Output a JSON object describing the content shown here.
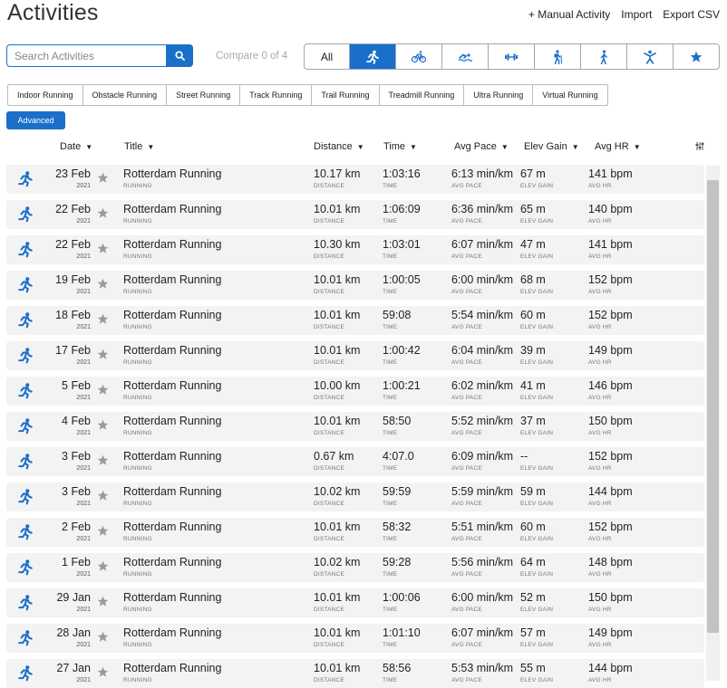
{
  "page": {
    "title": "Activities"
  },
  "actions": {
    "manual": "+ Manual Activity",
    "import": "Import",
    "export": "Export CSV"
  },
  "search": {
    "placeholder": "Search Activities"
  },
  "compare": {
    "label": "Compare 0 of 4"
  },
  "sport_filter": [
    {
      "label": "All",
      "icon": ""
    },
    {
      "label": "",
      "icon": "running-icon",
      "active": true
    },
    {
      "label": "",
      "icon": "cycling-icon"
    },
    {
      "label": "",
      "icon": "swimming-icon"
    },
    {
      "label": "",
      "icon": "strength-icon"
    },
    {
      "label": "",
      "icon": "hiking-icon"
    },
    {
      "label": "",
      "icon": "walking-icon"
    },
    {
      "label": "",
      "icon": "fitness-icon"
    },
    {
      "label": "",
      "icon": "favorite-star-icon"
    }
  ],
  "subtypes": [
    "Indoor Running",
    "Obstacle Running",
    "Street Running",
    "Track Running",
    "Trail Running",
    "Treadmill Running",
    "Ultra Running",
    "Virtual Running"
  ],
  "advanced": {
    "label": "Advanced"
  },
  "columns": {
    "date": "Date",
    "title": "Title",
    "distance": "Distance",
    "time": "Time",
    "avg_pace": "Avg Pace",
    "elev_gain": "Elev Gain",
    "avg_hr": "Avg HR"
  },
  "sublabels": {
    "type": "RUNNING",
    "distance": "DISTANCE",
    "time": "TIME",
    "pace": "AVG PACE",
    "elev": "ELEV GAIN",
    "hr": "AVG HR"
  },
  "activities": [
    {
      "day": "23 Feb",
      "year": "2021",
      "title": "Rotterdam Running",
      "distance": "10.17 km",
      "time": "1:03:16",
      "pace": "6:13 min/km",
      "elev": "67 m",
      "hr": "141 bpm"
    },
    {
      "day": "22 Feb",
      "year": "2021",
      "title": "Rotterdam Running",
      "distance": "10.01 km",
      "time": "1:06:09",
      "pace": "6:36 min/km",
      "elev": "65 m",
      "hr": "140 bpm"
    },
    {
      "day": "22 Feb",
      "year": "2021",
      "title": "Rotterdam Running",
      "distance": "10.30 km",
      "time": "1:03:01",
      "pace": "6:07 min/km",
      "elev": "47 m",
      "hr": "141 bpm"
    },
    {
      "day": "19 Feb",
      "year": "2021",
      "title": "Rotterdam Running",
      "distance": "10.01 km",
      "time": "1:00:05",
      "pace": "6:00 min/km",
      "elev": "68 m",
      "hr": "152 bpm"
    },
    {
      "day": "18 Feb",
      "year": "2021",
      "title": "Rotterdam Running",
      "distance": "10.01 km",
      "time": "59:08",
      "pace": "5:54 min/km",
      "elev": "60 m",
      "hr": "152 bpm"
    },
    {
      "day": "17 Feb",
      "year": "2021",
      "title": "Rotterdam Running",
      "distance": "10.01 km",
      "time": "1:00:42",
      "pace": "6:04 min/km",
      "elev": "39 m",
      "hr": "149 bpm"
    },
    {
      "day": "5 Feb",
      "year": "2021",
      "title": "Rotterdam Running",
      "distance": "10.00 km",
      "time": "1:00:21",
      "pace": "6:02 min/km",
      "elev": "41 m",
      "hr": "146 bpm"
    },
    {
      "day": "4 Feb",
      "year": "2021",
      "title": "Rotterdam Running",
      "distance": "10.01 km",
      "time": "58:50",
      "pace": "5:52 min/km",
      "elev": "37 m",
      "hr": "150 bpm"
    },
    {
      "day": "3 Feb",
      "year": "2021",
      "title": "Rotterdam Running",
      "distance": "0.67 km",
      "time": "4:07.0",
      "pace": "6:09 min/km",
      "elev": "--",
      "hr": "152 bpm"
    },
    {
      "day": "3 Feb",
      "year": "2021",
      "title": "Rotterdam Running",
      "distance": "10.02 km",
      "time": "59:59",
      "pace": "5:59 min/km",
      "elev": "59 m",
      "hr": "144 bpm"
    },
    {
      "day": "2 Feb",
      "year": "2021",
      "title": "Rotterdam Running",
      "distance": "10.01 km",
      "time": "58:32",
      "pace": "5:51 min/km",
      "elev": "60 m",
      "hr": "152 bpm"
    },
    {
      "day": "1 Feb",
      "year": "2021",
      "title": "Rotterdam Running",
      "distance": "10.02 km",
      "time": "59:28",
      "pace": "5:56 min/km",
      "elev": "64 m",
      "hr": "148 bpm"
    },
    {
      "day": "29 Jan",
      "year": "2021",
      "title": "Rotterdam Running",
      "distance": "10.01 km",
      "time": "1:00:06",
      "pace": "6:00 min/km",
      "elev": "52 m",
      "hr": "150 bpm"
    },
    {
      "day": "28 Jan",
      "year": "2021",
      "title": "Rotterdam Running",
      "distance": "10.01 km",
      "time": "1:01:10",
      "pace": "6:07 min/km",
      "elev": "57 m",
      "hr": "149 bpm"
    },
    {
      "day": "27 Jan",
      "year": "2021",
      "title": "Rotterdam Running",
      "distance": "10.01 km",
      "time": "58:56",
      "pace": "5:53 min/km",
      "elev": "55 m",
      "hr": "144 bpm"
    }
  ],
  "colors": {
    "accent": "#1a6fc9",
    "row_bg": "#f3f3f3",
    "star": "#9a9a9a"
  }
}
